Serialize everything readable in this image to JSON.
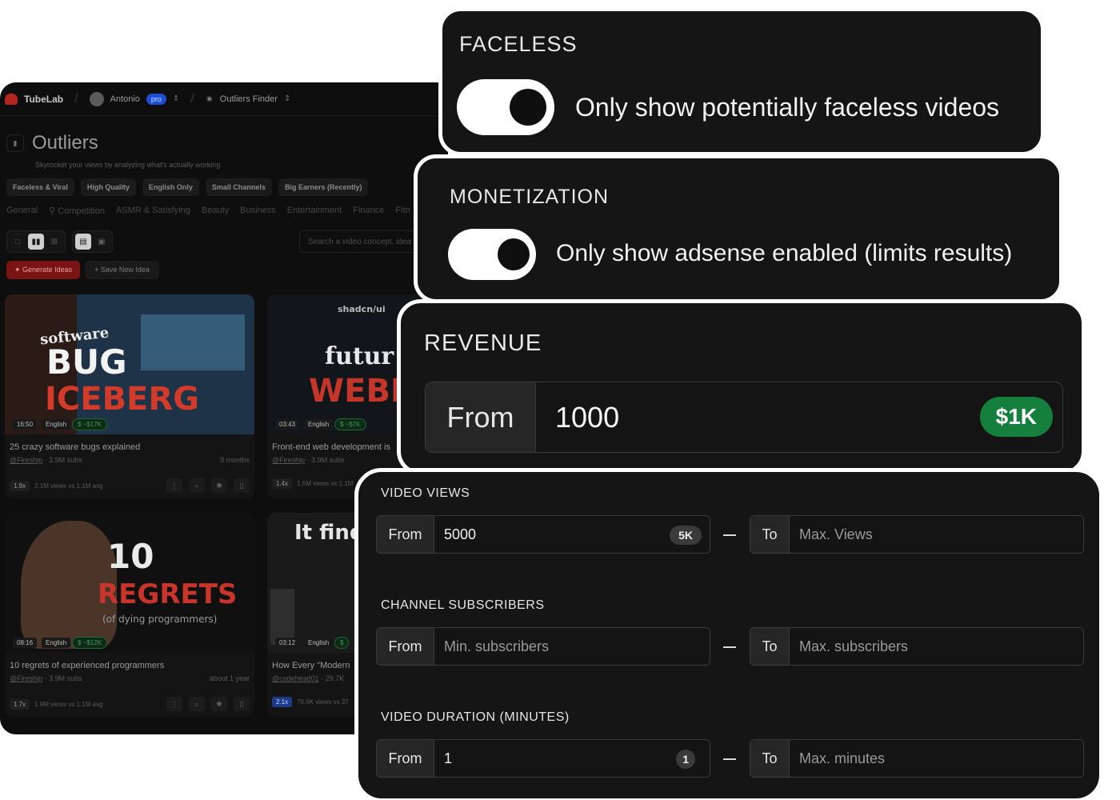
{
  "app": {
    "brand": "TubeLab",
    "user": "Antonio",
    "plan_badge": "pro",
    "tool": "Outliers Finder",
    "page_title": "Outliers",
    "page_subtitle": "Skyrocket your views by analyzing what's actually working",
    "chips": [
      "Faceless & Viral",
      "High Quality",
      "English Only",
      "Small Channels",
      "Big Earners (Recently)"
    ],
    "categories": [
      "General",
      "Competition",
      "ASMR & Satisfying",
      "Beauty",
      "Business",
      "Entertainment",
      "Finance",
      "Fitn"
    ],
    "search_placeholder": "Search a video concept, idea",
    "generate_label": "Generate Ideas",
    "save_label": "+ Save New Idea",
    "cards": [
      {
        "thumb_text_1": "software",
        "thumb_text_2": "BUG",
        "thumb_text_3": "ICEBERG",
        "duration": "16:50",
        "language": "English",
        "revenue": "$ ~$17K",
        "title": "25 crazy software bugs explained",
        "channel": "@Fireship",
        "subs": "3.9M subs",
        "age": "9 months",
        "multiplier": "1.9x",
        "views_note": "2.1M views vs 1.1M avg"
      },
      {
        "thumb_text_1": "shadcn/ui",
        "thumb_text_2": "futur",
        "thumb_text_3": "WEBD",
        "duration": "03:43",
        "language": "English",
        "revenue": "$ ~$7K",
        "title": "Front-end web development is",
        "channel": "@Fireship",
        "subs": "3.9M subs",
        "age": "",
        "multiplier": "1.4x",
        "views_note": "1.6M views vs 1.1M"
      },
      {
        "thumb_text_1": "10",
        "thumb_text_2": "REGRETS",
        "thumb_text_3": "(of dying programmers)",
        "duration": "08:16",
        "language": "English",
        "revenue": "$ ~$12K",
        "title": "10 regrets of experienced programmers",
        "channel": "@Fireship",
        "subs": "3.9M subs",
        "age": "about 1 year",
        "multiplier": "1.7x",
        "views_note": "1.9M views vs 1.1M avg"
      },
      {
        "thumb_text_1": "It find",
        "thumb_text_2": "",
        "thumb_text_3": "",
        "duration": "03:12",
        "language": "English",
        "revenue": "$",
        "title": "How Every \"Modern",
        "channel": "@codehead01",
        "subs": "29.7K",
        "age": "",
        "multiplier": "2.1x",
        "views_note": "78.6K views vs 37"
      }
    ]
  },
  "faceless": {
    "label": "FACELESS",
    "toggle_on": true,
    "toggle_label": "Only show potentially faceless videos"
  },
  "monetization": {
    "label": "MONETIZATION",
    "toggle_on": true,
    "toggle_label": "Only show adsense enabled (limits results)"
  },
  "revenue": {
    "label": "REVENUE",
    "from_label": "From",
    "value": "1000",
    "badge": "$1K"
  },
  "filters": {
    "video_views": {
      "label": "VIDEO VIEWS",
      "from_label": "From",
      "from_value": "5000",
      "from_badge": "5K",
      "to_label": "To",
      "to_placeholder": "Max. Views"
    },
    "channel_subscribers": {
      "label": "CHANNEL SUBSCRIBERS",
      "from_label": "From",
      "from_placeholder": "Min. subscribers",
      "to_label": "To",
      "to_placeholder": "Max. subscribers"
    },
    "video_duration": {
      "label": "VIDEO DURATION (MINUTES)",
      "from_label": "From",
      "from_value": "1",
      "from_badge": "1",
      "to_label": "To",
      "to_placeholder": "Max. minutes"
    }
  },
  "colors": {
    "panel_bg": "#151515",
    "panel_border": "#ffffff",
    "revenue_badge": "#15803d",
    "generate_button": "#7a1414",
    "pro_badge": "#1d4ed8"
  }
}
